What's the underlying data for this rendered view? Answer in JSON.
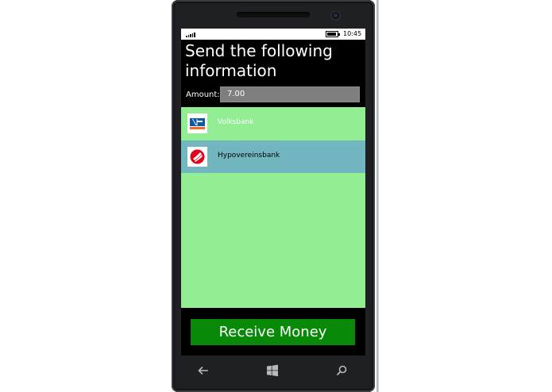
{
  "status_bar": {
    "time": "10:45",
    "icons": [
      "signal-icon",
      "battery-icon"
    ]
  },
  "page": {
    "title": "Send the following information"
  },
  "amount": {
    "label": "Amount:",
    "value": "7.00"
  },
  "banks": [
    {
      "name": "Volksbank",
      "icon": "volksbank-logo-icon"
    },
    {
      "name": "Hypovereinsbank",
      "icon": "hypovereinsbank-logo-icon"
    }
  ],
  "actions": {
    "receive_label": "Receive Money"
  },
  "nav_bar": {
    "icons": [
      "back-arrow-icon",
      "windows-start-icon",
      "search-icon"
    ]
  },
  "colors": {
    "list_background": "#93ed93",
    "selected_row": "#72b7c0",
    "button_green": "#088a08",
    "screen_background": "#000000",
    "input_background": "#7e7e7e"
  }
}
